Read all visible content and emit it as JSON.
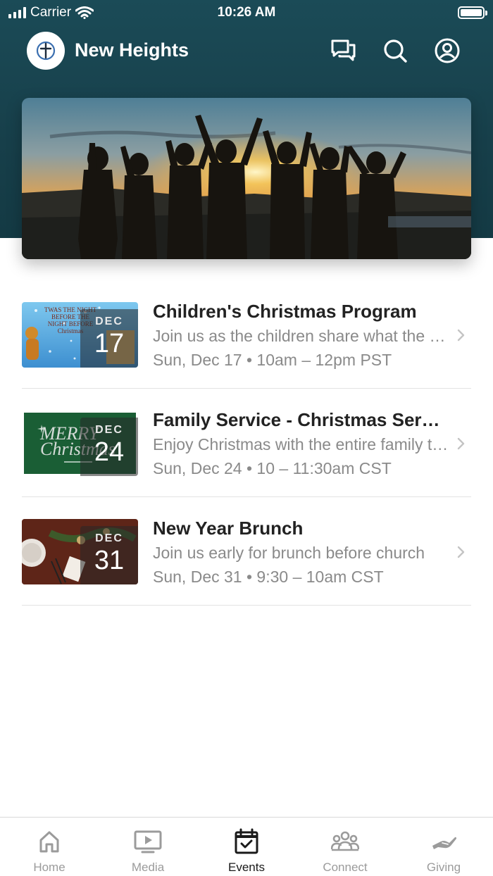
{
  "status_bar": {
    "carrier": "Carrier",
    "time": "10:26 AM"
  },
  "header": {
    "title": "New Heights",
    "icons": [
      "chat-icon",
      "search-icon",
      "profile-icon"
    ]
  },
  "hero": {
    "icon": "hero-image"
  },
  "events": [
    {
      "title": "Children's Christmas Program",
      "description": "Join us as the children share what the true meaning of Christmas is",
      "time": "Sun, Dec 17 • 10am – 12pm PST",
      "month": "DEC",
      "day": "17",
      "thumb_text": "TWAS THE NIGHT BEFORE THE NIGHT BEFORE Christmas"
    },
    {
      "title": "Family Service - Christmas Service",
      "description": "Enjoy Christmas with the entire family this year",
      "time": "Sun, Dec 24 • 10 – 11:30am CST",
      "month": "DEC",
      "day": "24",
      "thumb_text": "MERRY Christmas"
    },
    {
      "title": "New Year Brunch",
      "description": "Join us early for brunch before church",
      "time": "Sun, Dec 31 • 9:30 – 10am CST",
      "month": "DEC",
      "day": "31",
      "thumb_text": ""
    }
  ],
  "tabs": [
    {
      "label": "Home",
      "icon": "home-icon",
      "active": false
    },
    {
      "label": "Media",
      "icon": "media-icon",
      "active": false
    },
    {
      "label": "Events",
      "icon": "calendar-icon",
      "active": true
    },
    {
      "label": "Connect",
      "icon": "group-icon",
      "active": false
    },
    {
      "label": "Giving",
      "icon": "giving-hand-icon",
      "active": false
    }
  ],
  "colors": {
    "header_bg": "#1b4b57",
    "text_primary": "#222222",
    "text_secondary": "#8a8a8a",
    "tab_active": "#1a1a1a",
    "tab_inactive": "#9b9b9b"
  }
}
